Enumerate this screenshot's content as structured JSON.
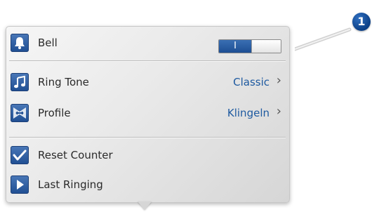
{
  "callout": {
    "number": "1"
  },
  "menu": {
    "bell": {
      "label": "Bell",
      "toggle_on_text": "I",
      "icon": "bell-icon",
      "state": "on"
    },
    "ring_tone": {
      "label": "Ring Tone",
      "value": "Classic",
      "chevron": "›",
      "icon": "music-note-icon"
    },
    "profile": {
      "label": "Profile",
      "value": "Klingeln",
      "chevron": "›",
      "icon": "profile-icon"
    },
    "reset_counter": {
      "label": "Reset Counter",
      "icon": "checkmark-icon"
    },
    "last_ringing": {
      "label": "Last Ringing",
      "icon": "play-icon"
    }
  },
  "colors": {
    "accent": "#1e5aa0",
    "icon_bg": "#2a5ca3",
    "panel": "#e6e6e6"
  }
}
